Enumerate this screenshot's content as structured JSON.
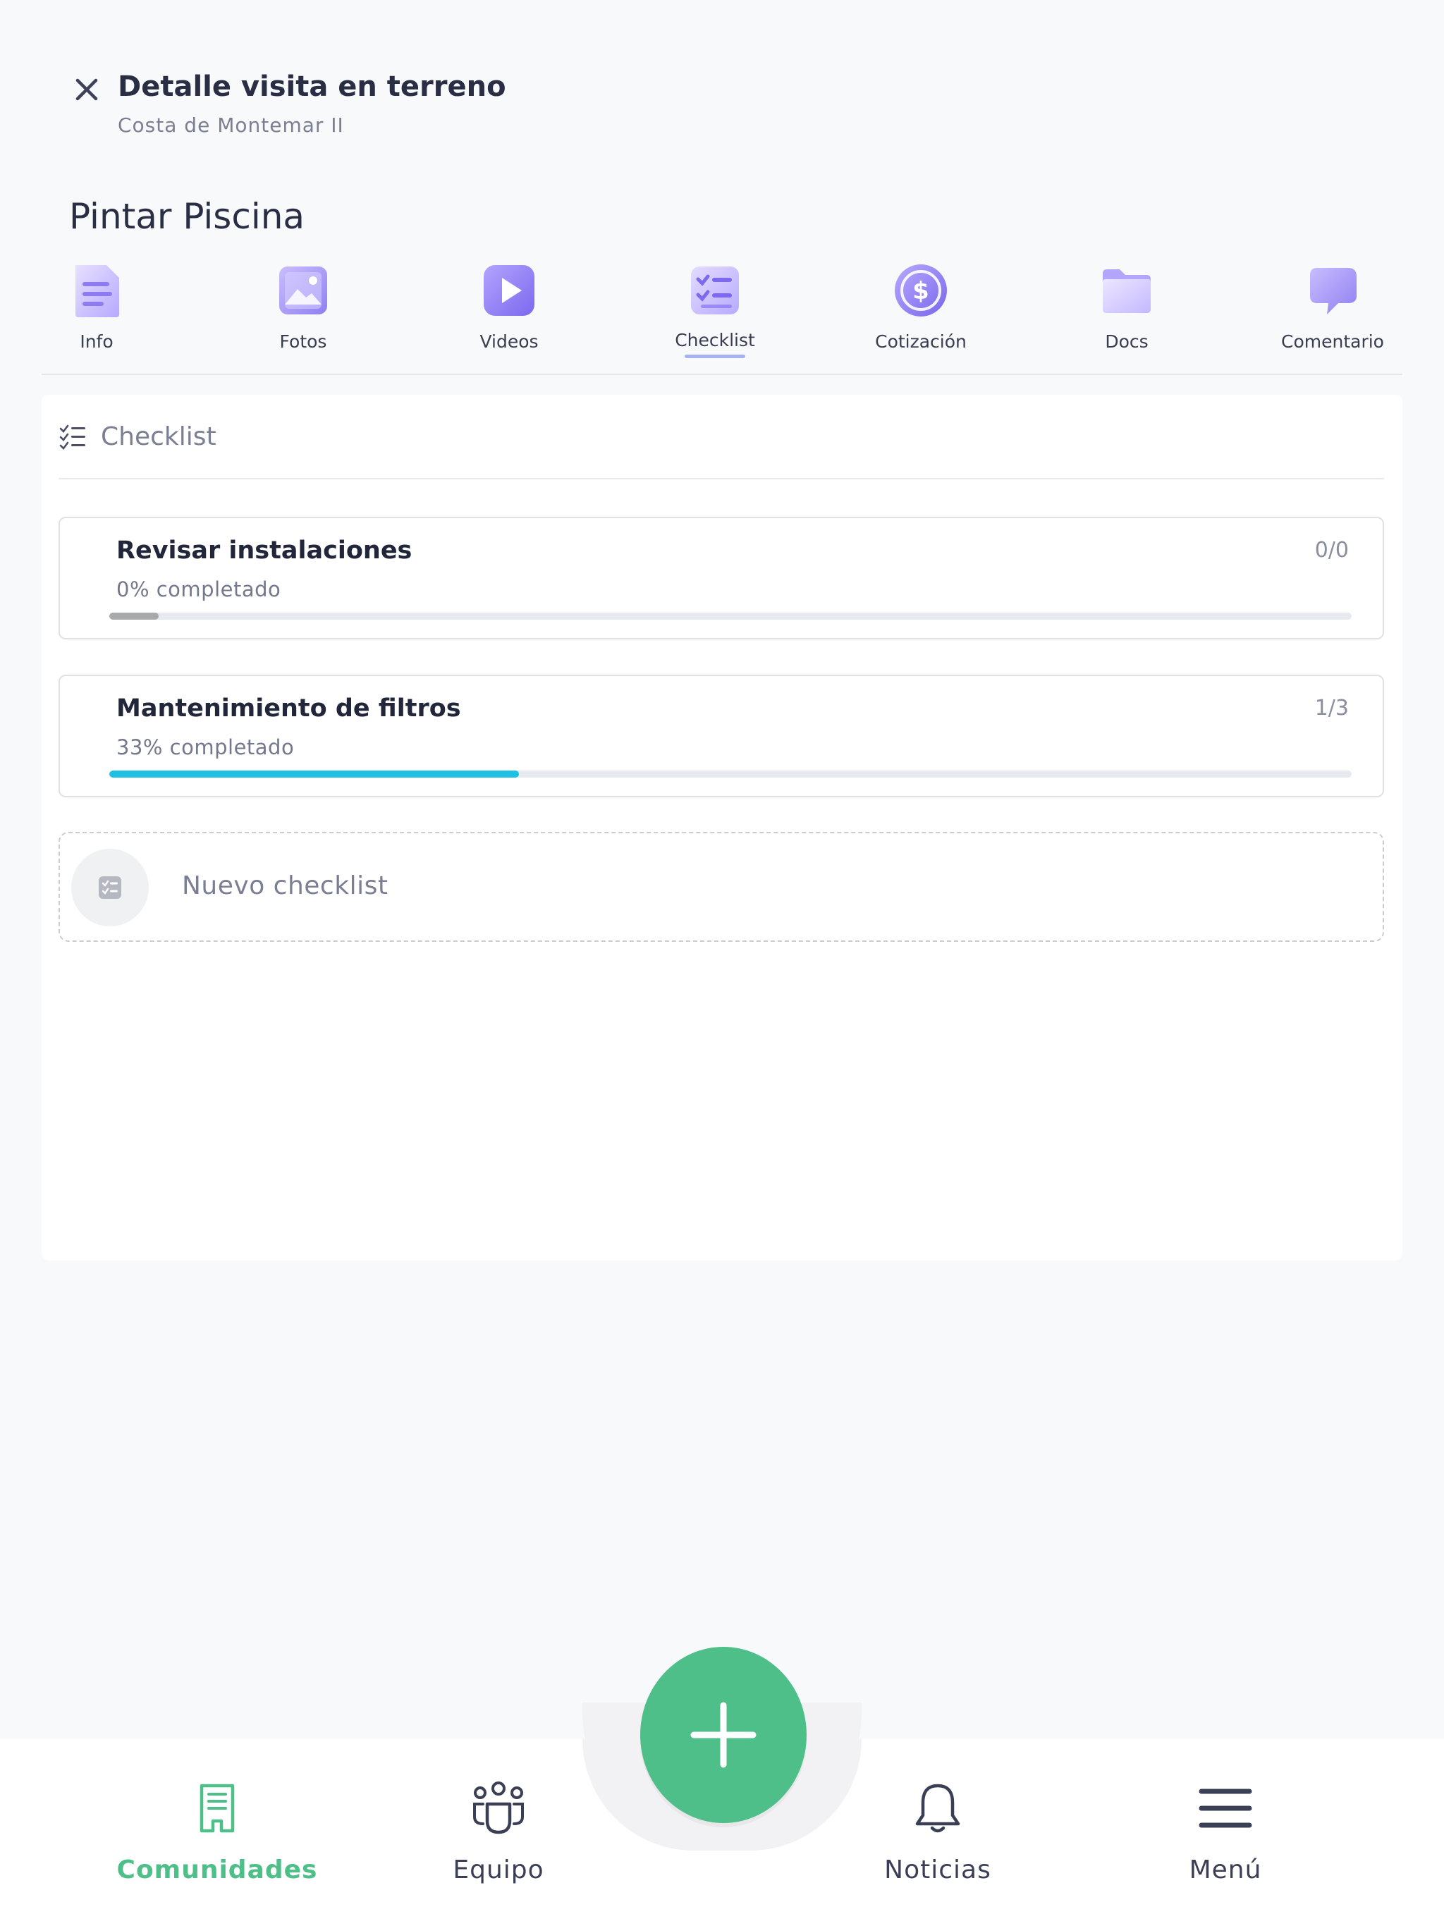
{
  "header": {
    "title": "Detalle visita en terreno",
    "subtitle": "Costa de Montemar II"
  },
  "task": {
    "title": "Pintar Piscina"
  },
  "tabs": [
    {
      "label": "Info",
      "icon": "document-icon"
    },
    {
      "label": "Fotos",
      "icon": "image-icon"
    },
    {
      "label": "Videos",
      "icon": "play-icon"
    },
    {
      "label": "Checklist",
      "icon": "checklist-icon",
      "active": true
    },
    {
      "label": "Cotización",
      "icon": "dollar-coin-icon"
    },
    {
      "label": "Docs",
      "icon": "folder-icon"
    },
    {
      "label": "Comentario",
      "icon": "chat-bubble-icon"
    }
  ],
  "checklist_section": {
    "label": "Checklist",
    "items": [
      {
        "name": "Revisar instalaciones",
        "count": "0/0",
        "percent_text": "0% completado",
        "progress": 0,
        "fill_color": "#a7a9ad"
      },
      {
        "name": "Mantenimiento de filtros",
        "count": "1/3",
        "percent_text": "33% completado",
        "progress": 33,
        "fill_color": "#1ec1e4"
      }
    ],
    "new_label": "Nuevo checklist"
  },
  "bottom_nav": {
    "items": [
      {
        "label": "Comunidades",
        "icon": "building-icon",
        "active": true
      },
      {
        "label": "Equipo",
        "icon": "team-icon"
      },
      {
        "label": "Noticias",
        "icon": "bell-icon"
      },
      {
        "label": "Menú",
        "icon": "hamburger-menu-icon"
      }
    ],
    "fab_icon": "plus-icon"
  },
  "colors": {
    "accent_green": "#4fbf8a",
    "progress_cyan": "#1ec1e4",
    "tab_icon_purple": "#8f7ff0"
  }
}
